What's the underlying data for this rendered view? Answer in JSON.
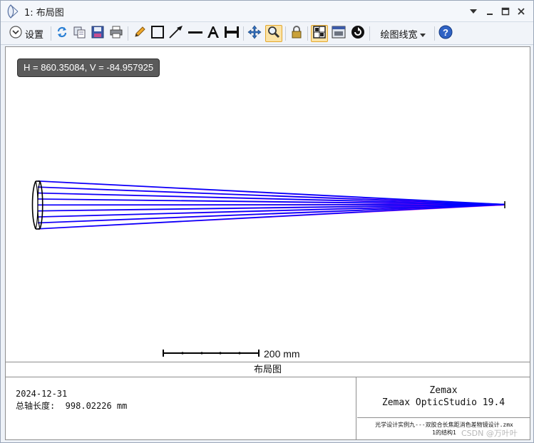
{
  "window": {
    "title": "1: 布局图"
  },
  "toolbar": {
    "settings_label": "设置",
    "linewidth_label": "绘图线宽",
    "icons": [
      "settings-dropdown-icon",
      "refresh-icon",
      "copy-icon",
      "save-icon",
      "print-icon",
      "pencil-icon",
      "rectangle-icon",
      "arrow-line-icon",
      "line-icon",
      "text-icon",
      "dimension-icon",
      "pan-icon",
      "zoom-icon",
      "lock-icon",
      "layout-icon",
      "window-icon",
      "rotate-icon",
      "dropdown-arrow-icon",
      "help-icon"
    ],
    "active": [
      "zoom-icon",
      "layout-icon"
    ]
  },
  "plot": {
    "coordinate_readout": "H = 860.35084, V = -84.957925",
    "scale_label": "200 mm",
    "ray_colors": [
      "#0000ff",
      "#00a000",
      "#e000e0"
    ]
  },
  "info": {
    "section_title": "布局图",
    "date": "2024-12-31",
    "axial_length": "总轴长度:  998.02226 mm",
    "brand": "Zemax",
    "product": "Zemax OpticStudio 19.4",
    "file_name": "光学设计实例九---双胶合长焦距消色差物镜设计.zmx",
    "configuration": "1的结构1"
  },
  "watermark": "CSDN @万叶叶"
}
